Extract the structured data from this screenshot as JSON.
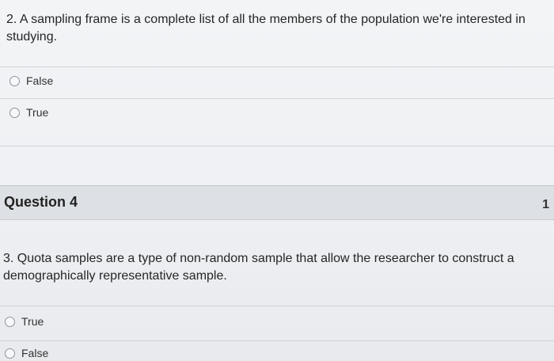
{
  "question2": {
    "text": "2. A sampling frame is a complete list of all the members of the population we're interested in studying.",
    "options": [
      {
        "label": "False"
      },
      {
        "label": "True"
      }
    ]
  },
  "question4": {
    "title": "Question 4",
    "points": "1",
    "text": "3. Quota samples are a type of non-random sample that allow the researcher to construct a demographically representative sample.",
    "options": [
      {
        "label": "True"
      },
      {
        "label": "False"
      }
    ]
  }
}
